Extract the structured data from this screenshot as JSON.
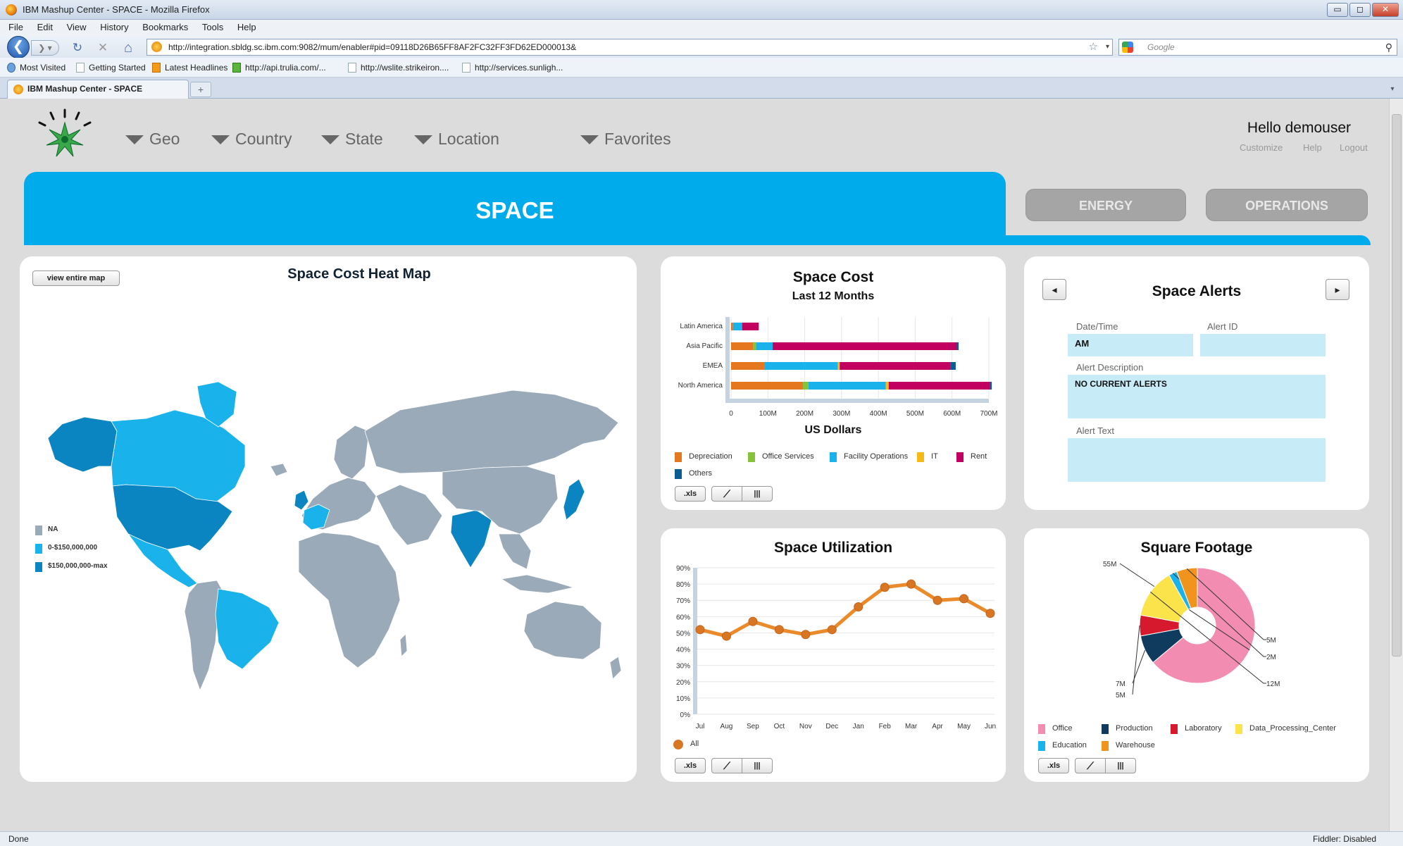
{
  "browser": {
    "window_title": "IBM Mashup Center - SPACE - Mozilla Firefox",
    "menu": [
      "File",
      "Edit",
      "View",
      "History",
      "Bookmarks",
      "Tools",
      "Help"
    ],
    "url": "http://integration.sbldg.sc.ibm.com:9082/mum/enabler#pid=09118D26B65FF8AF2FC32FF3FD62ED000013&",
    "search_placeholder": "Google",
    "bookmarks": [
      "Most Visited",
      "Getting Started",
      "Latest Headlines",
      "http://api.trulia.com/...",
      "http://wslite.strikeiron....",
      "http://services.sunligh..."
    ],
    "tab_title": "IBM Mashup Center - SPACE",
    "status_left": "Done",
    "status_right": "Fiddler: Disabled",
    "win_btns": {
      "min": "▭",
      "max": "◻",
      "close": "✕"
    },
    "icons": {
      "back": "❮",
      "forward": "❯ ▾",
      "reload": "↻",
      "stop": "✕",
      "home": "⌂",
      "star": "☆",
      "drop": "▾",
      "mag": "⚲",
      "newtab": "+",
      "tablist": "▾"
    }
  },
  "header": {
    "nav": [
      "Geo",
      "Country",
      "State",
      "Location",
      "Favorites"
    ],
    "greeting": "Hello demouser",
    "links": [
      "Customize",
      "Help",
      "Logout"
    ],
    "active_tab": "SPACE",
    "tabs": [
      "ENERGY",
      "OPERATIONS"
    ]
  },
  "heatmap": {
    "title": "Space Cost Heat Map",
    "button": "view entire map",
    "legend": [
      {
        "label": "NA",
        "color": "#9aaab9"
      },
      {
        "label": "0-$150,000,000",
        "color": "#1ab2ea"
      },
      {
        "label": "$150,000,000-max",
        "color": "#0b85c2"
      }
    ]
  },
  "space_cost": {
    "title": "Space Cost",
    "subtitle": "Last 12 Months",
    "xlabel": "US Dollars",
    "buttons": {
      "xls": ".xls",
      "line": "⟋",
      "bars": "|||"
    }
  },
  "alerts": {
    "title": "Space Alerts",
    "prev": "◂",
    "next": "▸",
    "date_label": "Date/Time",
    "date_value": "AM",
    "id_label": "Alert ID",
    "id_value": "",
    "desc_label": "Alert Description",
    "desc_value": "NO CURRENT ALERTS",
    "text_label": "Alert Text",
    "text_value": ""
  },
  "utilization": {
    "title": "Space Utilization"
  },
  "footage": {
    "title": "Square Footage"
  },
  "chart_data": [
    {
      "type": "bar",
      "orientation": "horizontal",
      "stacked": true,
      "title": "Space Cost",
      "subtitle": "Last 12 Months",
      "xlabel": "US Dollars",
      "categories": [
        "Latin America",
        "Asia Pacific",
        "EMEA",
        "North America"
      ],
      "xlim": [
        0,
        700
      ],
      "ticks": [
        "0",
        "100M",
        "200M",
        "300M",
        "400M",
        "500M",
        "600M",
        "700M"
      ],
      "series": [
        {
          "name": "Depreciation",
          "color": "#e5771e",
          "values": [
            5,
            60,
            90,
            195
          ]
        },
        {
          "name": "Office Services",
          "color": "#86c23a",
          "values": [
            0,
            8,
            0,
            15
          ]
        },
        {
          "name": "Facility Operations",
          "color": "#1ab2ea",
          "values": [
            25,
            45,
            200,
            210
          ]
        },
        {
          "name": "IT",
          "color": "#f5b918",
          "values": [
            0,
            0,
            5,
            8
          ]
        },
        {
          "name": "Rent",
          "color": "#c2005f",
          "values": [
            45,
            500,
            300,
            275
          ]
        },
        {
          "name": "Others",
          "color": "#0b5c8f",
          "values": [
            0,
            5,
            15,
            5
          ]
        }
      ],
      "legend_position": "bottom"
    },
    {
      "type": "line",
      "title": "Space Utilization",
      "categories": [
        "Jul",
        "Aug",
        "Sep",
        "Oct",
        "Nov",
        "Dec",
        "Jan",
        "Feb",
        "Mar",
        "Apr",
        "May",
        "Jun"
      ],
      "ylim": [
        0,
        90
      ],
      "yticks": [
        "0%",
        "10%",
        "20%",
        "30%",
        "40%",
        "50%",
        "60%",
        "70%",
        "80%",
        "90%"
      ],
      "series": [
        {
          "name": "All",
          "color": "#ea8a2a",
          "values": [
            52,
            48,
            57,
            52,
            49,
            52,
            66,
            78,
            80,
            70,
            71,
            62
          ]
        }
      ],
      "legend_position": "bottom"
    },
    {
      "type": "pie",
      "donut": true,
      "title": "Square Footage",
      "slices": [
        {
          "name": "Office",
          "value": 55,
          "label": "55M",
          "color": "#f28cb1"
        },
        {
          "name": "Production",
          "value": 7,
          "label": "7M",
          "color": "#0f3b5f"
        },
        {
          "name": "Laboratory",
          "value": 5,
          "label": "5M",
          "color": "#d7192d"
        },
        {
          "name": "Data_Processing_Center",
          "value": 12,
          "label": "12M",
          "color": "#fbe34a"
        },
        {
          "name": "Education",
          "value": 2,
          "label": "2M",
          "color": "#1ab2ea"
        },
        {
          "name": "Warehouse",
          "value": 5,
          "label": "5M",
          "color": "#f0941e"
        }
      ],
      "legend_position": "bottom"
    }
  ]
}
